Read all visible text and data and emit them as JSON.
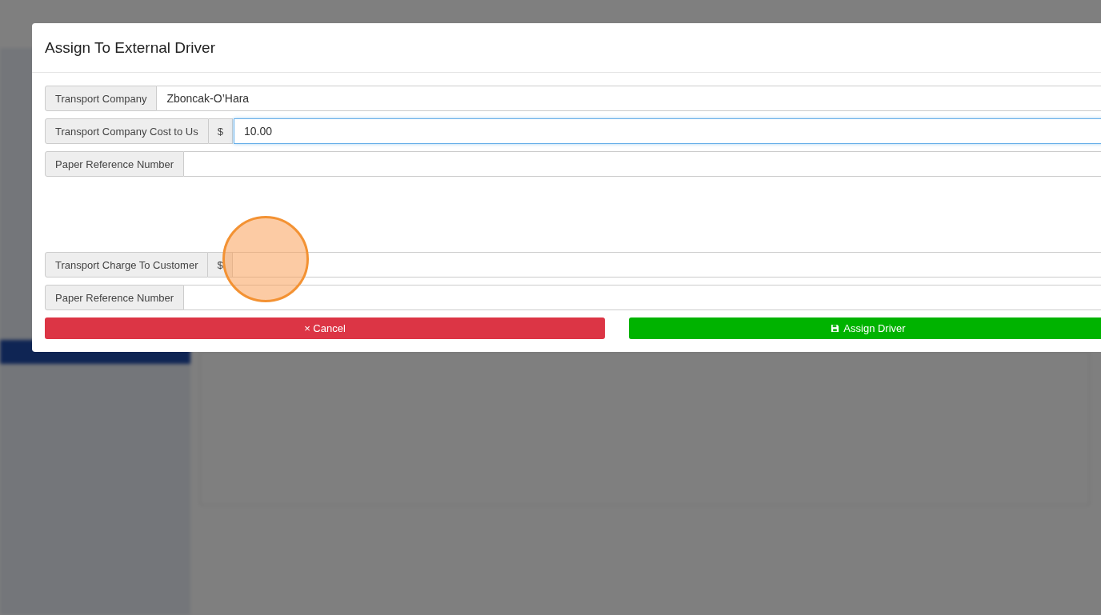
{
  "modal": {
    "title": "Assign To External Driver",
    "fields": [
      {
        "label": "Transport Company",
        "value": "Zboncak-O’Hara",
        "focused": false
      },
      {
        "label": "Transport Company Cost to Us",
        "prefix": "$",
        "value": "10.00",
        "focused": true
      },
      {
        "label": "Paper Reference Number",
        "focused": false
      },
      {
        "kind": "spacer"
      },
      {
        "label": "Transport Charge To Customer",
        "prefix": "$",
        "focused": false
      },
      {
        "label": "Paper Reference Number",
        "focused": false
      }
    ],
    "buttons": [
      {
        "kind": "cancel",
        "icon": "×",
        "label": "Cancel"
      },
      {
        "kind": "save",
        "label": "Assign Driver"
      }
    ]
  }
}
